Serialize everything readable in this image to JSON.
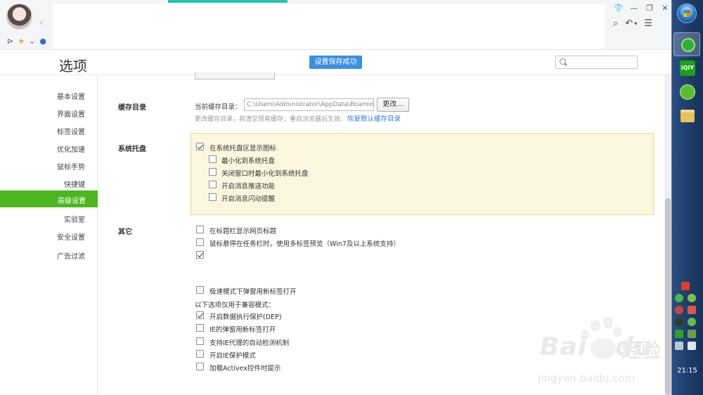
{
  "browser": {
    "bookmark_star": "★",
    "bookmark_arrow": "⌄",
    "window_controls": [
      "👕",
      "—",
      "❐",
      "✕"
    ],
    "toolbar": {
      "search": "⌕",
      "undo": "↶",
      "undo_arrow": "▾",
      "menu": "☰"
    },
    "nav_back": "‹",
    "sidebar_toggle": "⊳"
  },
  "header": {
    "title": "选项",
    "toast": "设置保存成功",
    "search_placeholder": ""
  },
  "sidebar": {
    "items": [
      "基本设置",
      "界面设置",
      "标签设置",
      "优化加速",
      "鼠标手势",
      "快捷键",
      "高级设置",
      "实验室",
      "安全设置",
      "广告过滤"
    ],
    "active": "高级设置"
  },
  "cache": {
    "section": "缓存目录",
    "label": "当前缓存目录：",
    "value": "C:\\Users\\Administrator\\AppData\\Roaming\\...",
    "change_button": "更改...",
    "hint": "更改缓存目录，将清空现有缓存，重启浏览器后生效。",
    "restore_link": "恢复默认缓存目录"
  },
  "tray": {
    "section": "系统托盘",
    "options": [
      {
        "label": "在系统托盘区显示图标",
        "checked": true
      },
      {
        "label": "最小化到系统托盘",
        "checked": false
      },
      {
        "label": "关闭窗口时最小化到系统托盘",
        "checked": false
      },
      {
        "label": "开启消息推送功能",
        "checked": false
      },
      {
        "label": "开启消息闪动提醒",
        "checked": false
      }
    ]
  },
  "other": {
    "section": "其它",
    "options": [
      {
        "label": "在标题栏显示网页标题",
        "checked": false
      },
      {
        "label": "鼠标悬停在任务栏时，使用多标签预览（Win7及以上系统支持）",
        "checked": false
      },
      {
        "label": "",
        "checked": true
      },
      {
        "label": "极速模式下弹窗用新标签打开",
        "checked": false
      }
    ],
    "compat_label": "以下选项仅用于兼容模式：",
    "compat_options": [
      {
        "label": "开启数据执行保护(DEP)",
        "checked": true
      },
      {
        "label": "IE的弹窗用新标签打开",
        "checked": false
      },
      {
        "label": "支持IE代理的自动检测机制",
        "checked": false
      },
      {
        "label": "开启IE保护模式",
        "checked": false
      },
      {
        "label": "加载Activex控件时提示",
        "checked": false
      }
    ]
  },
  "taskbar": {
    "iqiyi_label": "iQIY",
    "clock": "21:15"
  },
  "watermark": {
    "main": "Bai",
    "main2": "du",
    "cn": "经验",
    "url": "jingyan.baidu.com"
  },
  "colors": {
    "accent_green": "#4cb61f",
    "toast_blue": "#3d8fe0",
    "link_blue": "#2f7fd6",
    "tray_highlight_bg": "#fdf6de",
    "tray_highlight_border": "#eed796"
  }
}
